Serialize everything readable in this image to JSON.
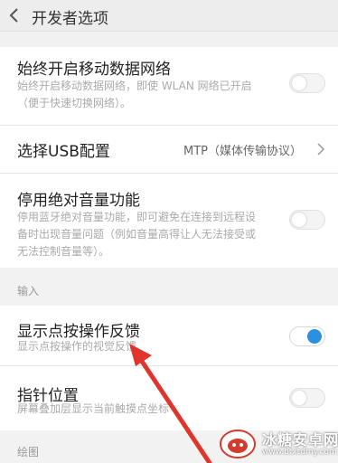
{
  "appbar": {
    "title": "开发者选项",
    "back_icon": "back-arrow-icon"
  },
  "mobile_data": {
    "title": "始终开启移动数据网络",
    "desc_line1": "始终开启移动数据网络，即使 WLAN 网络已开启",
    "desc_line2": "（便于快速切换网络）。",
    "enabled": false
  },
  "usb_config": {
    "title": "选择USB配置",
    "value": "MTP（媒体传输协议）",
    "chevron_icon": "chevron-right-icon"
  },
  "absolute_volume": {
    "title": "停用绝对音量功能",
    "desc_line1": "停用蓝牙绝对音量功能，即可避免在连接到远程设",
    "desc_line2": "备时出现音量问题（例如音量高得让人无法接受或",
    "desc_line3": "无法控制音量等）。",
    "enabled": false
  },
  "section_input": {
    "label": "输入"
  },
  "show_taps": {
    "title": "显示点按操作反馈",
    "desc": "显示点按操作的视觉反馈",
    "enabled": true,
    "accent": "#2c8fe0"
  },
  "pointer_location": {
    "title": "指针位置",
    "desc": "屏幕叠加层显示当前触摸点坐标",
    "enabled": false
  },
  "section_drawing": {
    "label": "绘图"
  },
  "annotation": {
    "color": "#e0342c",
    "icon": "red-arrow-annotation"
  },
  "watermark": {
    "name": "冰糖安卓网",
    "url": "www.btxtdmy.com"
  }
}
